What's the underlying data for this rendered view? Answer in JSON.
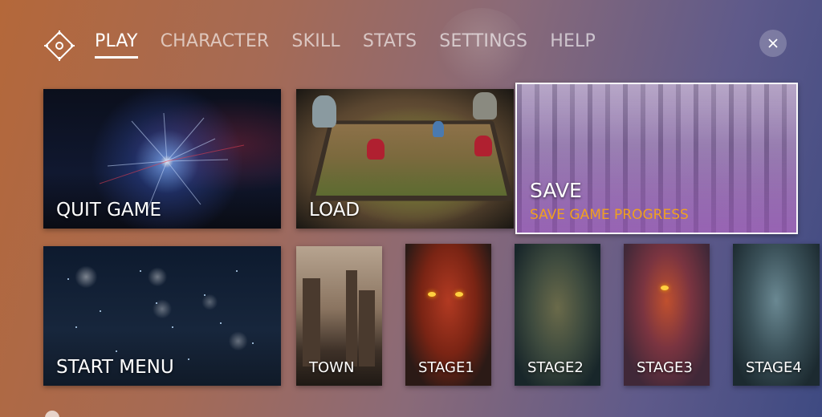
{
  "nav": {
    "tabs": [
      {
        "label": "PLAY",
        "active": true
      },
      {
        "label": "CHARACTER",
        "active": false
      },
      {
        "label": "SKILL",
        "active": false
      },
      {
        "label": "STATS",
        "active": false
      },
      {
        "label": "SETTINGS",
        "active": false
      },
      {
        "label": "HELP",
        "active": false
      }
    ],
    "close_icon": "close-icon",
    "logo_icon": "diamond-compass-icon"
  },
  "cards": {
    "quit": {
      "label": "QUIT GAME"
    },
    "load": {
      "label": "LOAD"
    },
    "save": {
      "label": "SAVE",
      "subtitle": "SAVE GAME PROGRESS"
    },
    "start_menu": {
      "label": "START MENU"
    }
  },
  "stages": [
    {
      "label": "TOWN"
    },
    {
      "label": "STAGE1"
    },
    {
      "label": "STAGE2"
    },
    {
      "label": "STAGE3"
    },
    {
      "label": "STAGE4"
    }
  ],
  "colors": {
    "accent": "#f0a020",
    "active_tab": "#ffffff",
    "inactive_tab": "#d8cbd0"
  }
}
